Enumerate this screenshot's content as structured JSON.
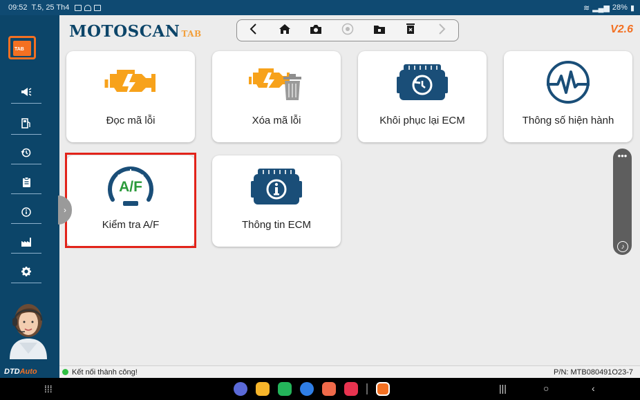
{
  "status_bar": {
    "time": "09:52",
    "date": "T.5, 25 Th4",
    "battery": "28%"
  },
  "sidebar": {
    "logo_text": "TAB",
    "items": [
      {
        "icon": "megaphone-icon",
        "glyph": "📢"
      },
      {
        "icon": "fuel-pump-icon",
        "glyph": "⛽"
      },
      {
        "icon": "history-icon",
        "glyph": "⟲"
      },
      {
        "icon": "clipboard-icon",
        "glyph": "📋"
      },
      {
        "icon": "info-icon",
        "glyph": "ⓘ"
      },
      {
        "icon": "factory-icon",
        "glyph": "🏭"
      },
      {
        "icon": "settings-gear-icon",
        "glyph": "⚙"
      }
    ],
    "brand": {
      "part1": "DTD",
      "part2": "Auto"
    }
  },
  "header": {
    "app_name": "MOTOSCAN",
    "app_suffix": "TAB",
    "version": "V2.6",
    "toolbar": [
      "back-icon",
      "home-icon",
      "camera-icon",
      "record-icon",
      "folder-icon",
      "delete-icon",
      "forward-icon"
    ]
  },
  "tiles": [
    {
      "label": "Đọc mã lỗi",
      "icon": "engine-warning-icon"
    },
    {
      "label": "Xóa mã lỗi",
      "icon": "engine-delete-icon"
    },
    {
      "label": "Khôi phục lại ECM",
      "icon": "ecm-restore-icon"
    },
    {
      "label": "Thông số hiện hành",
      "icon": "live-data-pulse-icon"
    },
    {
      "label": "Kiểm tra A/F",
      "icon": "af-gauge-icon",
      "badge": "A/F",
      "selected": true
    },
    {
      "label": "Thông tin ECM",
      "icon": "ecm-info-icon"
    }
  ],
  "status": {
    "connection": "Kết nối thành công!",
    "part_number": "P/N: MTB080491O23-7"
  },
  "colors": {
    "navy": "#0c4569",
    "orange": "#f37022",
    "green": "#2a9a3a",
    "highlight": "#e2231a"
  }
}
